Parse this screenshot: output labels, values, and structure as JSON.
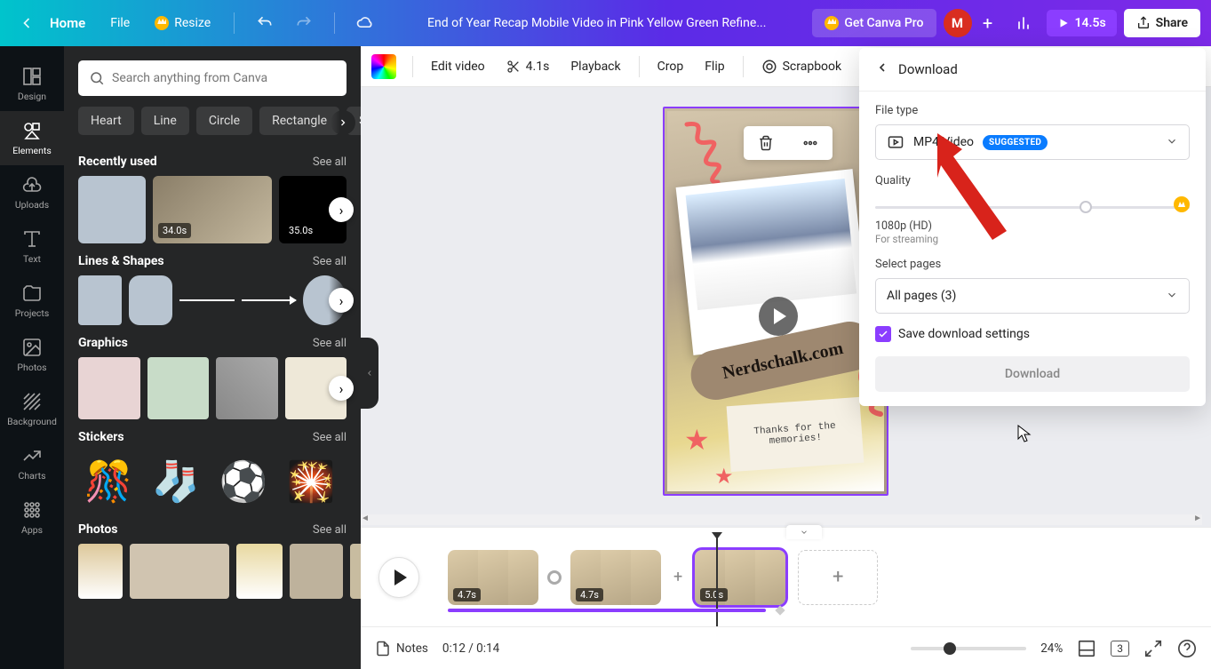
{
  "topbar": {
    "home": "Home",
    "file": "File",
    "resize": "Resize",
    "doc_title": "End of Year Recap Mobile Video in Pink Yellow Green Refine...",
    "get_pro": "Get Canva Pro",
    "avatar_initial": "M",
    "duration": "14.5s",
    "share": "Share"
  },
  "rail": {
    "design": "Design",
    "elements": "Elements",
    "uploads": "Uploads",
    "text": "Text",
    "projects": "Projects",
    "photos": "Photos",
    "background": "Background",
    "charts": "Charts",
    "apps": "Apps"
  },
  "panel": {
    "search_placeholder": "Search anything from Canva",
    "chips": [
      "Heart",
      "Line",
      "Circle",
      "Rectangle",
      "Spa"
    ],
    "see_all": "See all",
    "sections": {
      "recent": "Recently used",
      "lines": "Lines & Shapes",
      "graphics": "Graphics",
      "stickers": "Stickers",
      "photos": "Photos"
    },
    "recent_dur1": "34.0s",
    "recent_dur2": "35.0s"
  },
  "editbar": {
    "edit_video": "Edit video",
    "clip_dur": "4.1s",
    "playback": "Playback",
    "crop": "Crop",
    "flip": "Flip",
    "scrapbook": "Scrapbook"
  },
  "canvas": {
    "watermark": "Nerdschalk.com",
    "note": "Thanks for the memories!"
  },
  "download": {
    "title": "Download",
    "file_type_label": "File type",
    "file_type_value": "MP4 Video",
    "suggested": "SUGGESTED",
    "quality_label": "Quality",
    "quality_value": "1080p (HD)",
    "quality_sub": "For streaming",
    "pages_label": "Select pages",
    "pages_value": "All pages (3)",
    "save_settings": "Save download settings",
    "button": "Download"
  },
  "timeline": {
    "clip1_dur": "4.7s",
    "clip2_dur": "4.7s",
    "clip3_dur": "5.0s"
  },
  "status": {
    "notes": "Notes",
    "time": "0:12 / 0:14",
    "zoom": "24%",
    "page": "3"
  }
}
